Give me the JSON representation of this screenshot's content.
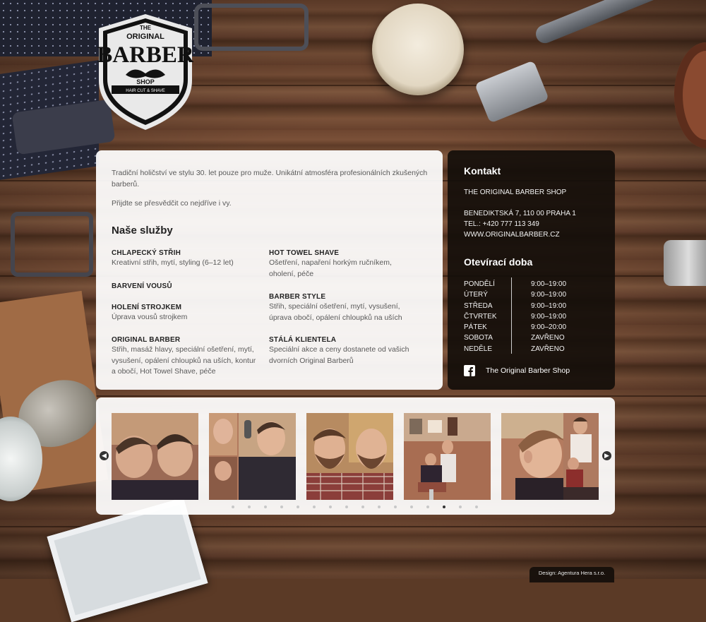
{
  "logo": {
    "line1": "THE",
    "line2": "ORIGINAL",
    "line3": "BARBER",
    "line4": "SHOP",
    "ribbon": "HAIR CUT & SHAVE"
  },
  "about": {
    "intro": "Tradiční holičství ve stylu 30. let pouze pro muže. Unikátní atmosféra profesionálních zkušených barberů.",
    "invite": "Přijdte se přesvědčit co nejdříve i vy.",
    "services_heading": "Naše služby",
    "services": [
      {
        "title": "CHLAPECKÝ STŘIH",
        "desc": "Kreativní střih, mytí, styling (6–12 let)"
      },
      {
        "title": "BARVENÍ VOUSŮ",
        "desc": ""
      },
      {
        "title": "HOLENÍ STROJKEM",
        "desc": "Úprava vousů strojkem"
      },
      {
        "title": "ORIGINAL BARBER",
        "desc": "Střih, masáž hlavy, speciální ošetření, mytí, vysušení, opálení chloupků na uších, kontur a obočí, Hot Towel Shave, péče"
      },
      {
        "title": "HOT TOWEL SHAVE",
        "desc": "Ošetření, napaření horkým ručníkem, oholení, péče"
      },
      {
        "title": "BARBER STYLE",
        "desc": "Střih, speciální ošetření, mytí, vysušení, úprava obočí, opálení chloupků na uších"
      },
      {
        "title": "STÁLÁ KLIENTELA",
        "desc": "Speciální akce a ceny dostanete od vašich dvorních Original Barberů"
      }
    ]
  },
  "contact": {
    "heading": "Kontakt",
    "name": "THE ORIGINAL BARBER SHOP",
    "address": "BENEDIKTSKÁ 7, 110 00 PRAHA 1",
    "phone": "TEL.: +420 777 113 349",
    "web": "WWW.ORIGINALBARBER.CZ",
    "hours_heading": "Otevírací doba",
    "hours": [
      {
        "day": "PONDĚLÍ",
        "time": "9:00–19:00"
      },
      {
        "day": "ÚTERÝ",
        "time": "9:00–19:00"
      },
      {
        "day": "STŘEDA",
        "time": "9:00–19:00"
      },
      {
        "day": "ČTVRTEK",
        "time": "9:00–19:00"
      },
      {
        "day": "PÁTEK",
        "time": "9:00–20:00"
      },
      {
        "day": "SOBOTA",
        "time": "ZAVŘENO"
      },
      {
        "day": "NEDĚLE",
        "time": "ZAVŘENO"
      }
    ],
    "facebook_label": "The Original Barber Shop"
  },
  "gallery": {
    "prev_icon": "chevron-left-icon",
    "next_icon": "chevron-right-icon",
    "dot_count": 16,
    "active_dot": 13,
    "photo_count": 6
  },
  "footer": {
    "credit": "Design: Agentura Hera s.r.o."
  },
  "colors": {
    "panel_light": "#ffffff",
    "panel_dark": "#140e0a",
    "text_body": "#5a5a5a",
    "text_heading": "#222222"
  }
}
